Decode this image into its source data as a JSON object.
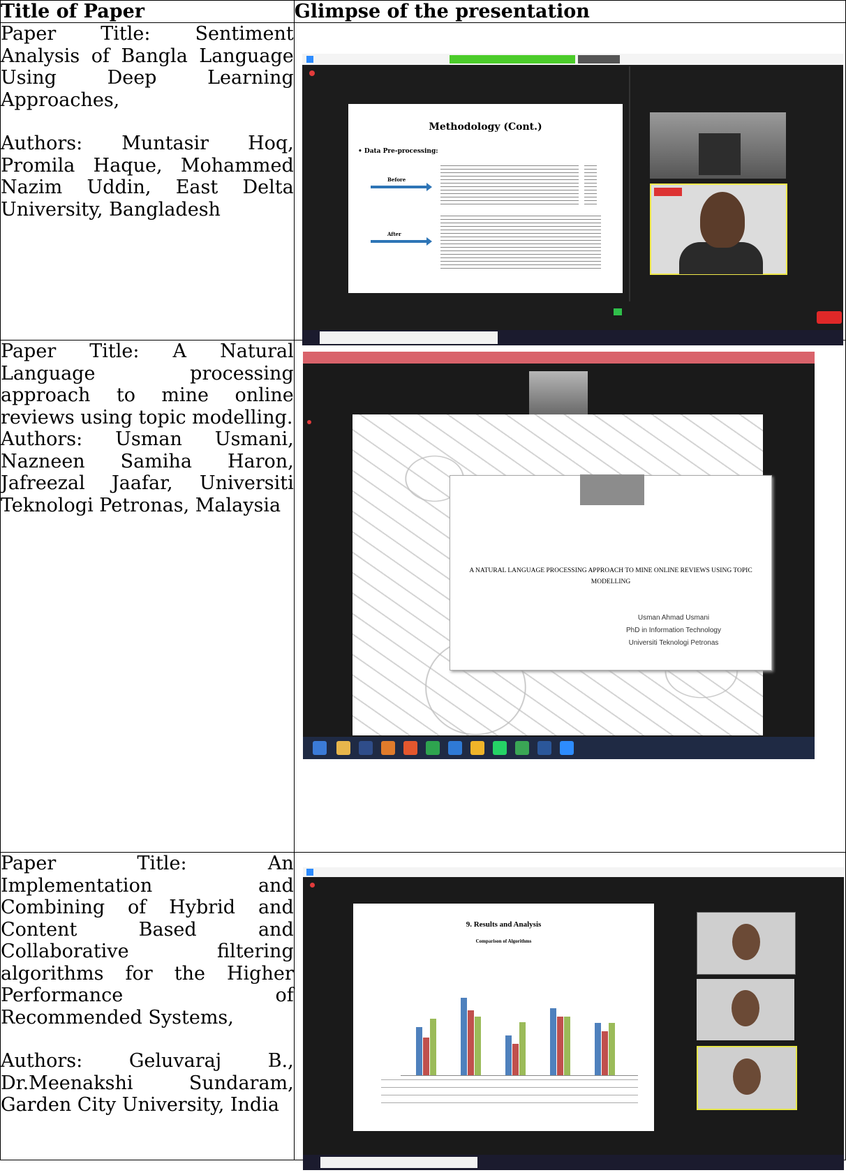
{
  "table": {
    "col1_header": "Title of Paper",
    "col2_header": "Glimpse of the presentation",
    "rows": [
      {
        "title_text": "Paper Title: Sentiment Analysis of Bangla Language Using Deep Learning Approaches,",
        "authors_text": "Authors: Muntasir Hoq, Promila Haque, Mohammed Nazim Uddin, East Delta University, Bangladesh"
      },
      {
        "title_text": "Paper Title: A Natural Language processing approach to mine online reviews using topic modelling.",
        "authors_text": "Authors: Usman Usmani, Nazneen Samiha Haron, Jafreezal Jaafar, Universiti Teknologi Petronas, Malaysia"
      },
      {
        "title_text": "Paper Title: An Implementation and Combining of Hybrid and Content Based and Collaborative filtering algorithms for the Higher Performance of Recommended Systems,",
        "authors_text": "Authors: Geluvaraj B., Dr.Meenakshi Sundaram, Garden City University, India"
      }
    ]
  },
  "shot1": {
    "slide_title": "Methodology (Cont.)",
    "bullet": "• Data Pre-processing:",
    "label_before": "Before",
    "label_after": "After"
  },
  "shot2": {
    "slide_title": "A NATURAL LANGUAGE PROCESSING APPROACH TO MINE ONLINE REVIEWS USING TOPIC MODELLING",
    "presenter": "Usman Ahmad Usmani",
    "degree": "PhD in Information Technology",
    "university": "Universiti Teknologi Petronas"
  },
  "shot3": {
    "slide_title": "9. Results and Analysis",
    "chart_title": "Comparison of Algorithms"
  },
  "colors": {
    "zoom_blue": "#2d8cff",
    "leave_red": "#e02828",
    "bar_blue": "#4f81bd",
    "bar_red": "#c0504d",
    "bar_green": "#9bbb59"
  }
}
